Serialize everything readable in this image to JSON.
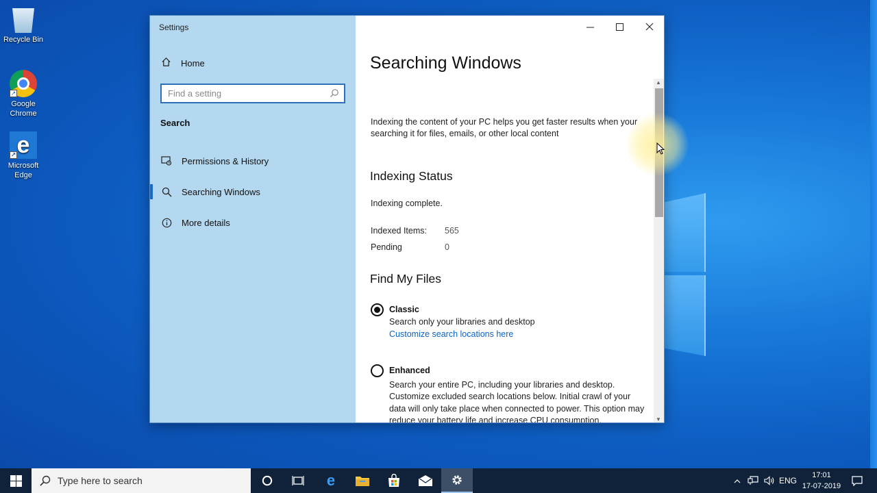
{
  "desktop": {
    "icons": [
      {
        "label": "Recycle Bin"
      },
      {
        "label": "Google Chrome"
      },
      {
        "label": "Microsoft Edge"
      }
    ]
  },
  "window": {
    "title": "Settings",
    "sidebar": {
      "home_label": "Home",
      "search_placeholder": "Find a setting",
      "section_label": "Search",
      "items": [
        {
          "label": "Permissions & History",
          "icon": "permissions-icon"
        },
        {
          "label": "Searching Windows",
          "icon": "search-icon",
          "active": true
        },
        {
          "label": "More details",
          "icon": "info-icon"
        }
      ]
    },
    "content": {
      "title": "Searching Windows",
      "description": "Indexing the content of your PC helps you get faster results when your searching it for files, emails, or other local content",
      "indexing_status_heading": "Indexing Status",
      "indexing_status_text": "Indexing complete.",
      "indexed_items_label": "Indexed Items:",
      "indexed_items_value": "565",
      "pending_label": "Pending",
      "pending_value": "0",
      "find_files_heading": "Find My Files",
      "classic_label": "Classic",
      "classic_desc": "Search only your libraries and desktop",
      "classic_link": "Customize search locations here",
      "enhanced_label": "Enhanced",
      "enhanced_desc": "Search your entire PC, including your libraries and desktop. Customize excluded search locations below. Initial crawl of your data will only take place when connected to power. This option may reduce your battery life and increase CPU consumption.",
      "selected_option": "Classic"
    }
  },
  "taskbar": {
    "search_placeholder": "Type here to search",
    "language": "ENG",
    "time": "17:01",
    "date": "17-07-2019"
  },
  "colors": {
    "accent": "#1a6ac4",
    "link": "#0a64c8",
    "sidebar_bg": "#b4d8f0",
    "taskbar_bg": "#10223a"
  }
}
